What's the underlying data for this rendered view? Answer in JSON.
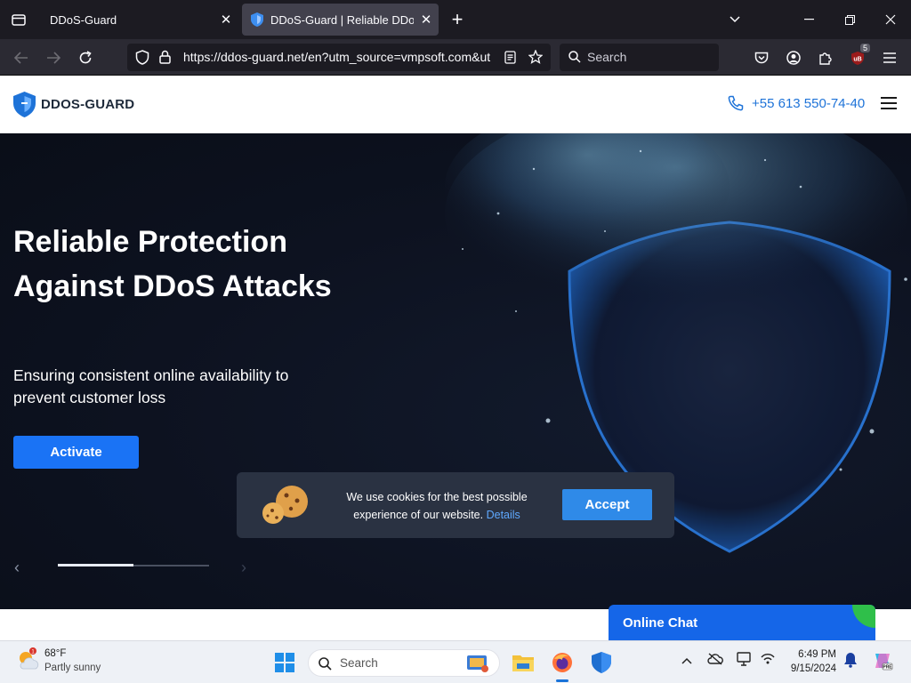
{
  "browser": {
    "tabs": [
      {
        "title": "DDoS-Guard",
        "active": false
      },
      {
        "title": "DDoS-Guard | Reliable DDoS Pr",
        "active": true
      }
    ],
    "url": "https://ddos-guard.net/en?utm_source=vmpsoft.com&ut",
    "search_placeholder": "Search",
    "extension_badge": "5"
  },
  "site": {
    "logo_text": "DDOS-GUARD",
    "phone": "+55 613 550-74-40",
    "hero": {
      "title": "Reliable Protection Against DDoS Attacks",
      "subtitle": "Ensuring consistent online availability to prevent customer loss",
      "cta": "Activate",
      "slider_progress": 0.5
    },
    "cookie": {
      "text": "We use cookies for the best possible experience of our website.",
      "link": "Details",
      "accept": "Accept"
    },
    "chat_label": "Online Chat"
  },
  "taskbar": {
    "weather_badge": "1",
    "weather_temp": "68°F",
    "weather_desc": "Partly sunny",
    "search_placeholder": "Search",
    "time": "6:49 PM",
    "date": "9/15/2024"
  },
  "colors": {
    "accent": "#1a73f5",
    "hero_bg": "#0d1220",
    "chat": "#1566e8"
  }
}
